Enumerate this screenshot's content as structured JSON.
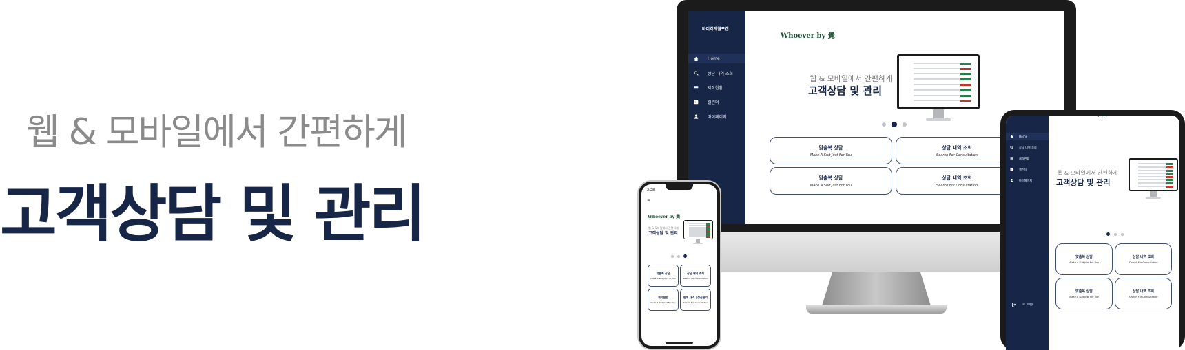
{
  "hero": {
    "subtitle": "웹 & 모바일에서 간편하게",
    "title": "고객상담 및 관리"
  },
  "app": {
    "brand": "바이각계월포캡",
    "logo": "Whoever by 覺",
    "nav": [
      {
        "label": "Home",
        "icon": "home-icon",
        "active": true
      },
      {
        "label": "상담 내역 조회",
        "icon": "search-icon",
        "active": false
      },
      {
        "label": "제작현황",
        "icon": "list-icon",
        "active": false
      },
      {
        "label": "캘린더",
        "icon": "calendar-icon",
        "active": false
      },
      {
        "label": "마이페이지",
        "icon": "user-icon",
        "active": false
      }
    ],
    "logout": "로그아웃",
    "banner": {
      "subtitle": "웹 & 모바일에서 간편하게",
      "title": "고객상담 및 관리"
    },
    "carousel": {
      "count": 3,
      "active_desktop": 1,
      "active_tablet": 0,
      "active_phone": 2
    },
    "cards": [
      {
        "title": "맞춤복 상담",
        "sub": "Make A Suit Just For You"
      },
      {
        "title": "상담 내역 조회",
        "sub": "Search For Consultation"
      },
      {
        "title": "맞춤복 상담",
        "sub": "Make A Suit Just For You"
      },
      {
        "title": "상담 내역 조회",
        "sub": "Search For Consultation"
      }
    ],
    "phone_cards": [
      {
        "title": "맞춤복 상담",
        "sub": "Make A Suit Just For You"
      },
      {
        "title": "상담 내역 조회",
        "sub": "Search For Consultation"
      },
      {
        "title": "제작현황",
        "sub": "Make A Suit Just For You"
      },
      {
        "title": "판매 내역 | 정산관리",
        "sub": "Search For Consultation"
      }
    ],
    "phone_time": "2:28",
    "menu_glyph": "≡"
  },
  "colors": {
    "navy": "#172647",
    "green_logo": "#1d4d33",
    "gray_text": "#8b8b8b"
  }
}
